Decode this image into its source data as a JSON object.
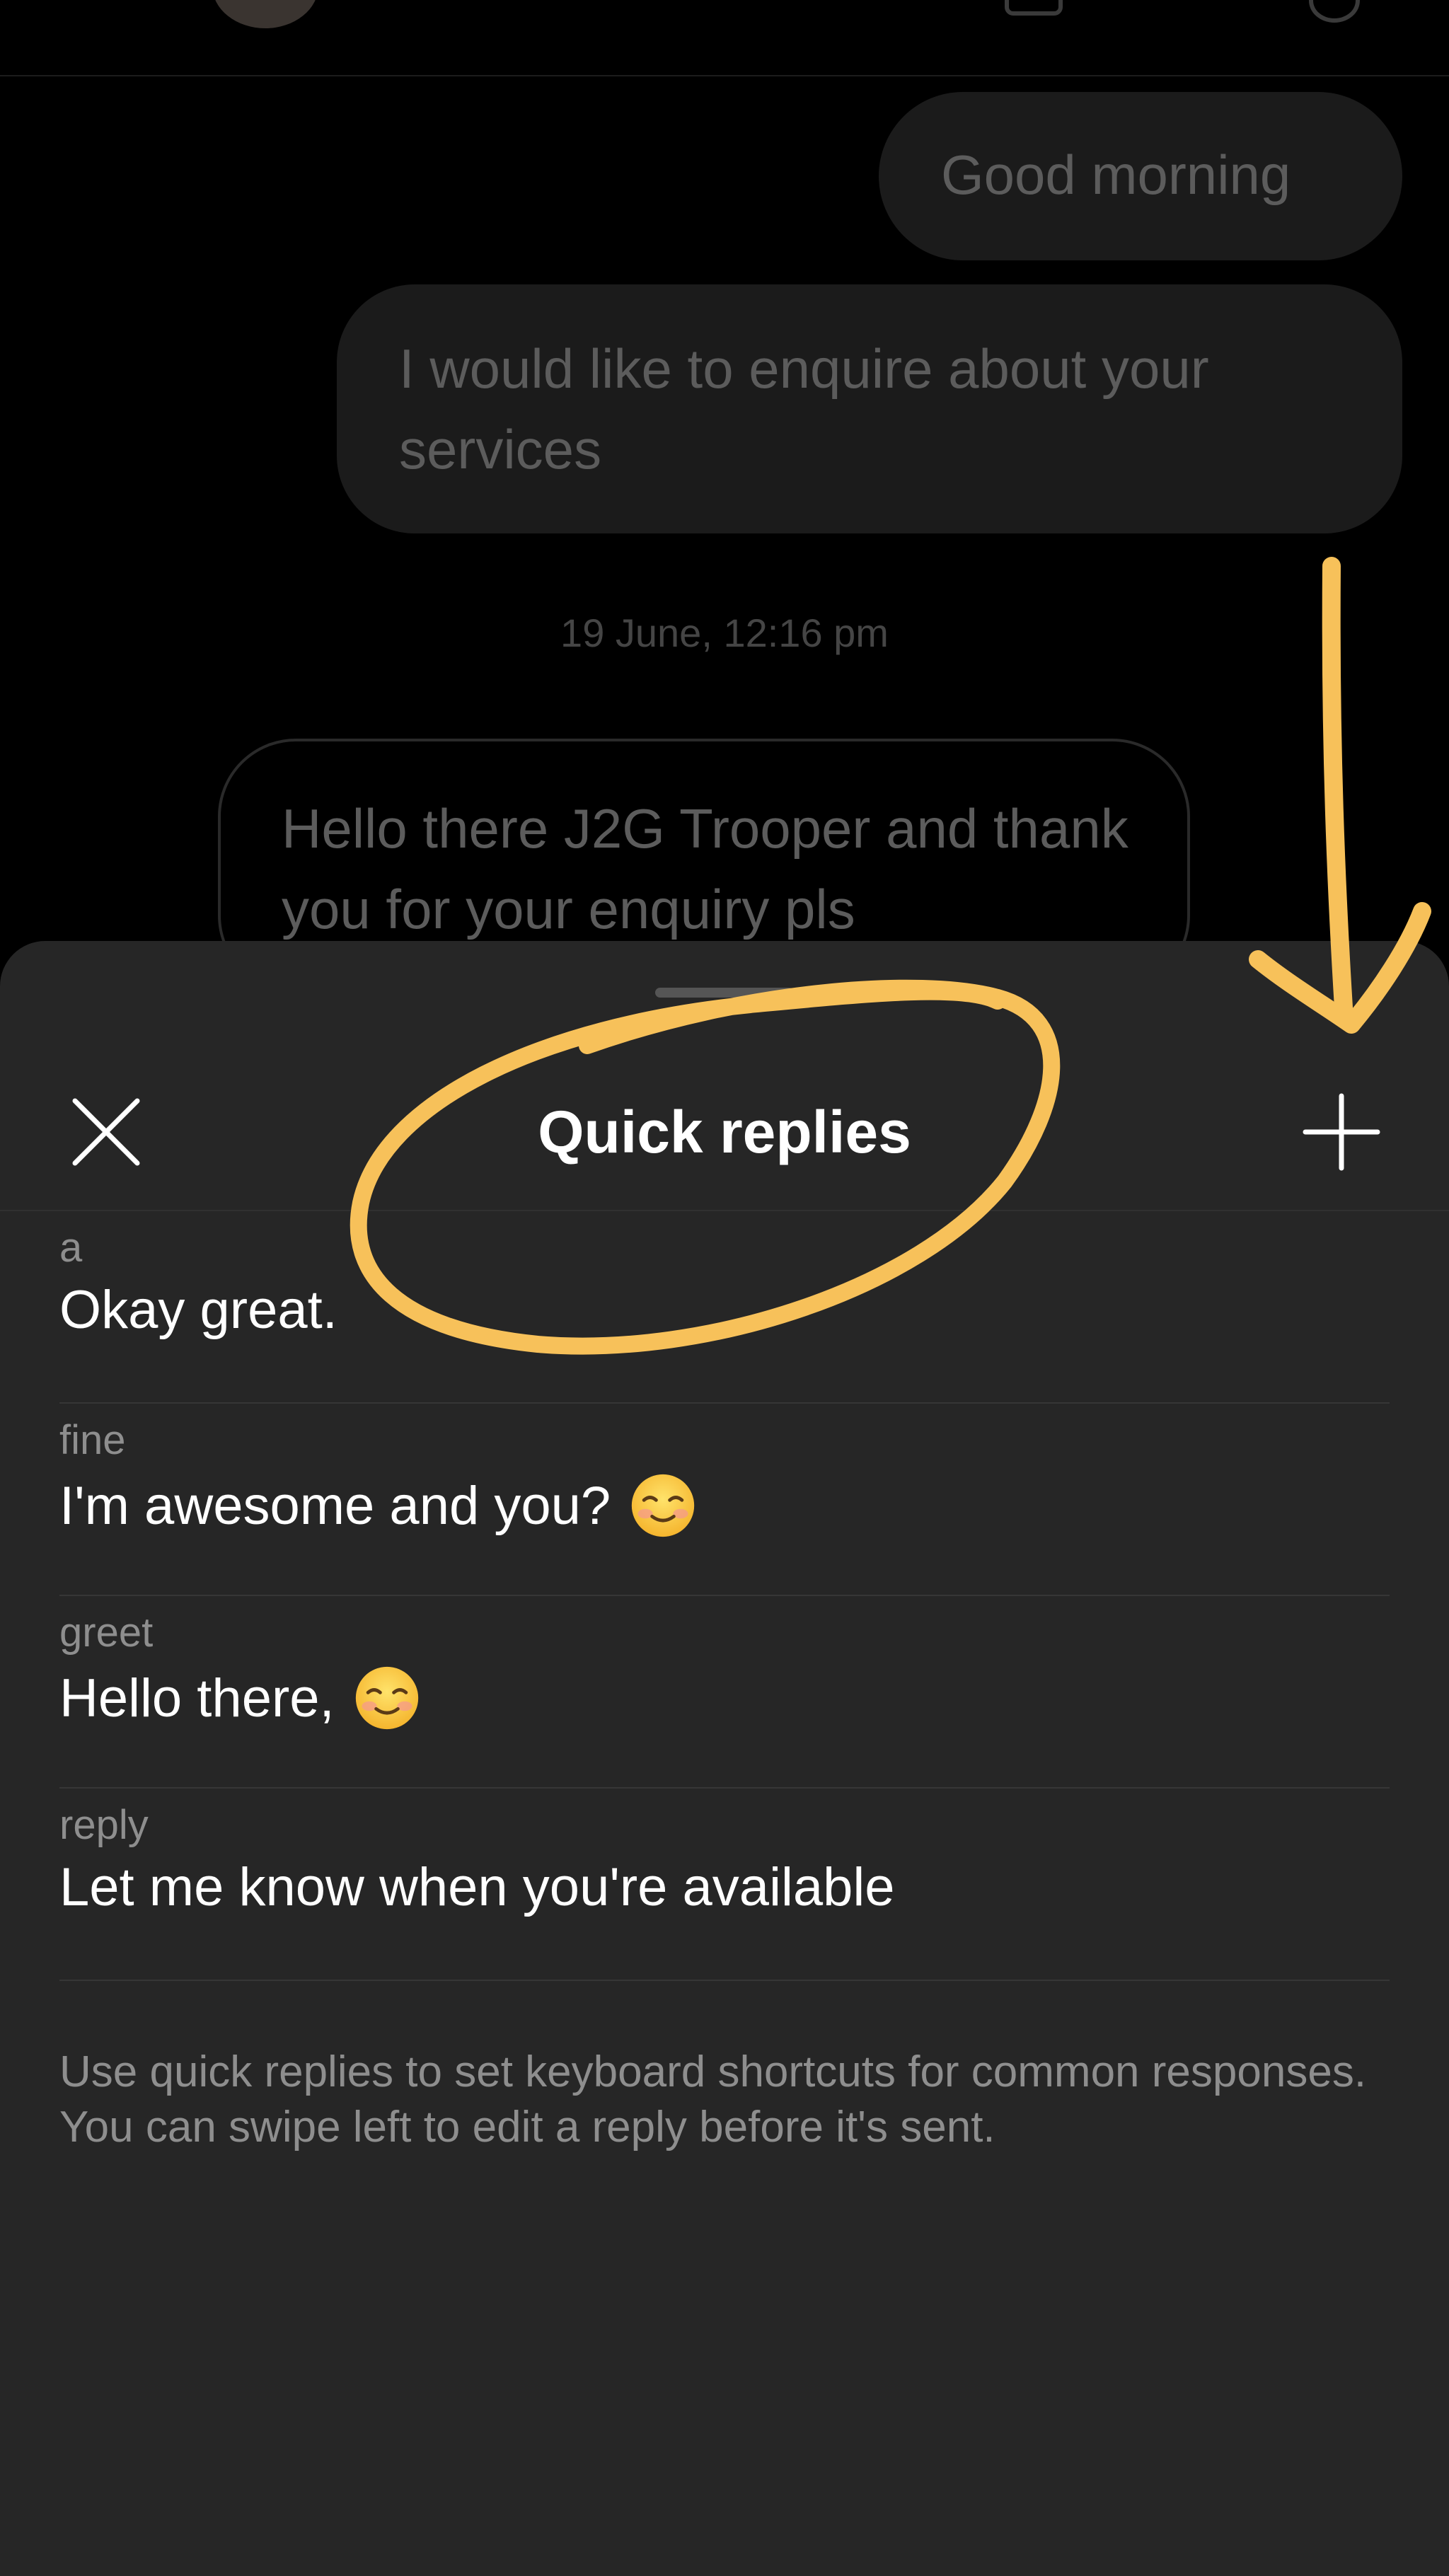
{
  "chat": {
    "messages": [
      {
        "direction": "outgoing",
        "text": "Good morning"
      },
      {
        "direction": "outgoing",
        "text": "I would like to enquire about your services"
      },
      {
        "direction": "incoming",
        "text": "Hello there J2G Trooper and thank you for your enquiry pls"
      }
    ],
    "timestamp": "19 June, 12:16 pm"
  },
  "sheet": {
    "title": "Quick replies",
    "close_icon": "close-icon",
    "add_icon": "plus-icon",
    "replies": [
      {
        "shortcut": "a",
        "message": "Okay great.",
        "emoji": ""
      },
      {
        "shortcut": "fine",
        "message": "I'm awesome and you?",
        "emoji": "smiling-face-emoji"
      },
      {
        "shortcut": "greet",
        "message": "Hello there,",
        "emoji": "smiling-face-emoji"
      },
      {
        "shortcut": "reply",
        "message": "Let me know when you're available",
        "emoji": ""
      }
    ],
    "footer_note": "Use quick replies to set keyboard shortcuts for common responses. You can swipe left to edit a reply before it's sent."
  },
  "colors": {
    "background": "#000000",
    "sheet": "#262626",
    "annotation": "#F7C15A",
    "primary_text": "#FFFFFF",
    "secondary_text": "#8E8E8E"
  }
}
